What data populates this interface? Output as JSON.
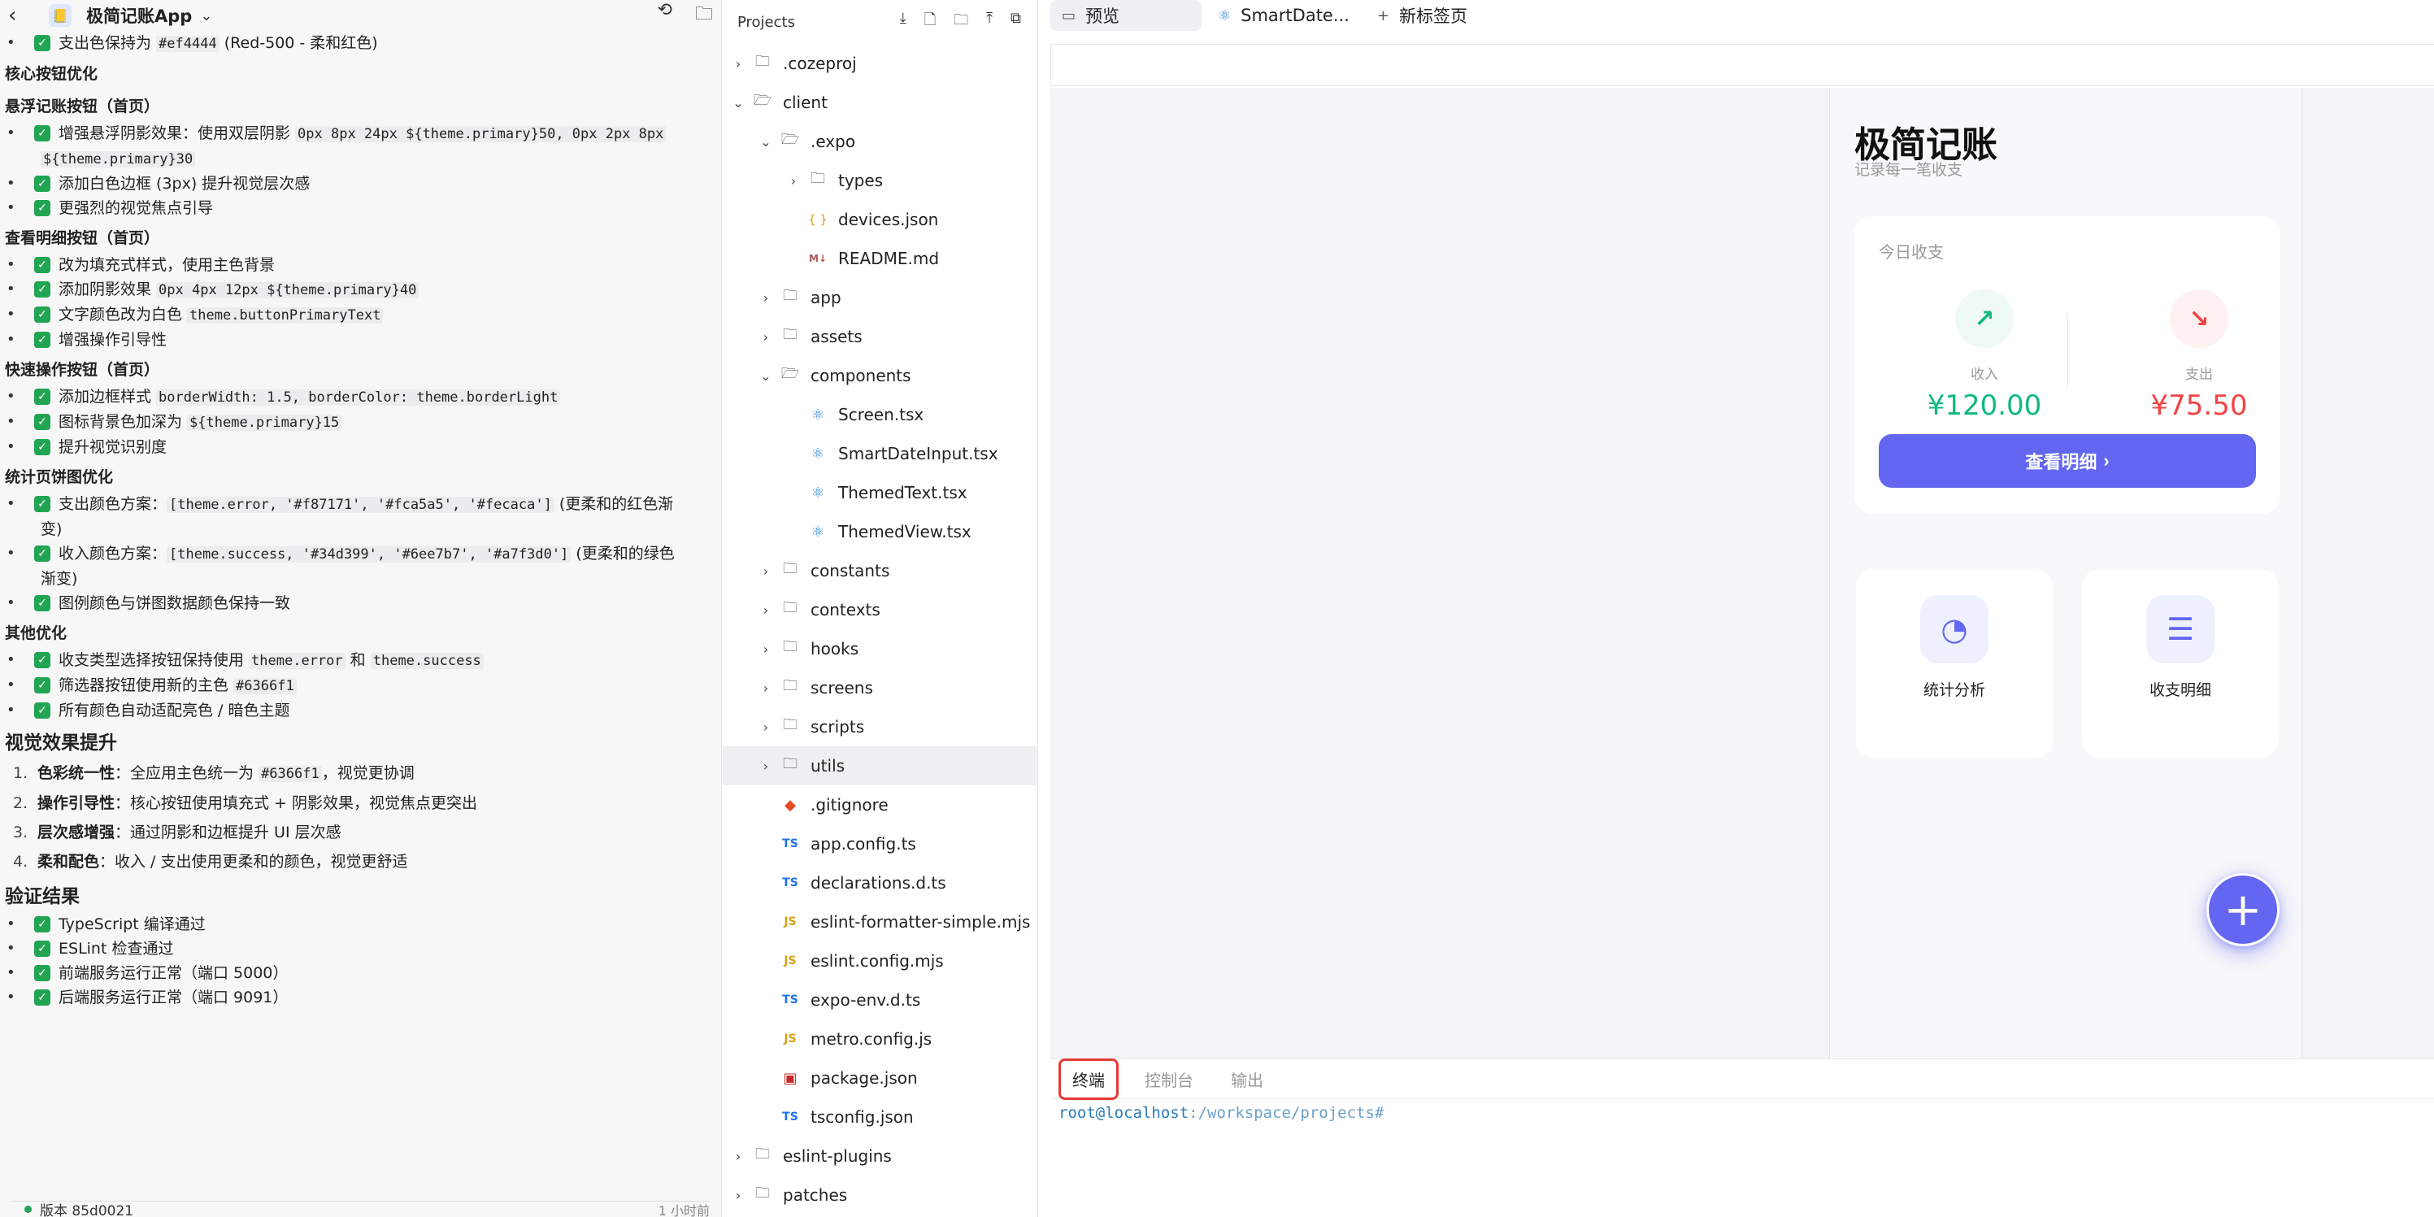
{
  "chat": {
    "app_name": "极简记账App",
    "items": [
      {
        "kind": "check",
        "text": "支出色保持为 ",
        "code": "#ef4444",
        "after": " (Red-500 - 柔和红色)"
      },
      {
        "kind": "h",
        "text": "核心按钮优化"
      },
      {
        "kind": "h",
        "text": "悬浮记账按钮（首页）"
      },
      {
        "kind": "check2",
        "line1": "增强悬浮阴影效果：使用双层阴影 ",
        "code1": "0px 8px 24px ${theme.primary}50, 0px 2px 8px",
        "code2": "${theme.primary}30"
      },
      {
        "kind": "check",
        "text": "添加白色边框 (3px) 提升视觉层次感"
      },
      {
        "kind": "check",
        "text": "更强烈的视觉焦点引导"
      },
      {
        "kind": "h",
        "text": "查看明细按钮（首页）"
      },
      {
        "kind": "check",
        "text": "改为填充式样式，使用主色背景"
      },
      {
        "kind": "check",
        "text": "添加阴影效果 ",
        "code": "0px 4px 12px ${theme.primary}40"
      },
      {
        "kind": "check",
        "text": "文字颜色改为白色 ",
        "code": "theme.buttonPrimaryText"
      },
      {
        "kind": "check",
        "text": "增强操作引导性"
      },
      {
        "kind": "h",
        "text": "快速操作按钮（首页）"
      },
      {
        "kind": "check",
        "text": "添加边框样式 ",
        "code": "borderWidth: 1.5, borderColor: theme.borderLight"
      },
      {
        "kind": "check",
        "text": "图标背景色加深为 ",
        "code": "${theme.primary}15"
      },
      {
        "kind": "check",
        "text": "提升视觉识别度"
      },
      {
        "kind": "h",
        "text": "统计页饼图优化"
      },
      {
        "kind": "check3",
        "text": "支出颜色方案：",
        "code": "[theme.error, '#f87171', '#fca5a5', '#fecaca']",
        "after": " (更柔和的红色渐",
        "wrap": "变)"
      },
      {
        "kind": "check3",
        "text": "收入颜色方案：",
        "code": "[theme.success, '#34d399', '#6ee7b7', '#a7f3d0']",
        "after": " (更柔和的绿色",
        "wrap": "渐变)"
      },
      {
        "kind": "check",
        "text": "图例颜色与饼图数据颜色保持一致"
      },
      {
        "kind": "h",
        "text": "其他优化"
      },
      {
        "kind": "check4",
        "text": "收支类型选择按钮保持使用 ",
        "code": "theme.error",
        "mid": " 和 ",
        "code2": "theme.success"
      },
      {
        "kind": "check",
        "text": "筛选器按钮使用新的主色 ",
        "code": "#6366f1"
      },
      {
        "kind": "check",
        "text": "所有颜色自动适配亮色 / 暗色主题"
      }
    ],
    "visual_heading": "视觉效果提升",
    "ordered": [
      {
        "num": "1.",
        "bold": "色彩统一性",
        "text": "：全应用主色统一为 ",
        "code": "#6366f1",
        "after": "，视觉更协调"
      },
      {
        "num": "2.",
        "bold": "操作引导性",
        "text": "：核心按钮使用填充式 + 阴影效果，视觉焦点更突出"
      },
      {
        "num": "3.",
        "bold": "层次感增强",
        "text": "：通过阴影和边框提升 UI 层次感"
      },
      {
        "num": "4.",
        "bold": "柔和配色",
        "text": "：收入 / 支出使用更柔和的颜色，视觉更舒适"
      }
    ],
    "verify_heading": "验证结果",
    "verify": [
      "TypeScript 编译通过",
      "ESLint 检查通过",
      "前端服务运行正常（端口 5000）",
      "后端服务运行正常（端口 9091）"
    ],
    "version": "版本 85d0021",
    "version_time": "1 小时前"
  },
  "tree": {
    "header": "Projects",
    "nodes": [
      {
        "depth": 0,
        "chev": "›",
        "icon": "folder",
        "name": ".cozeproj"
      },
      {
        "depth": 0,
        "chev": "⌄",
        "icon": "folder-open",
        "name": "client"
      },
      {
        "depth": 1,
        "chev": "⌄",
        "icon": "folder-open",
        "name": ".expo"
      },
      {
        "depth": 2,
        "chev": "›",
        "icon": "folder",
        "name": "types"
      },
      {
        "depth": 2,
        "chev": "",
        "icon": "json",
        "name": "devices.json"
      },
      {
        "depth": 2,
        "chev": "",
        "icon": "md",
        "name": "README.md"
      },
      {
        "depth": 1,
        "chev": "›",
        "icon": "folder",
        "name": "app"
      },
      {
        "depth": 1,
        "chev": "›",
        "icon": "folder",
        "name": "assets"
      },
      {
        "depth": 1,
        "chev": "⌄",
        "icon": "folder-open",
        "name": "components"
      },
      {
        "depth": 2,
        "chev": "",
        "icon": "react",
        "name": "Screen.tsx"
      },
      {
        "depth": 2,
        "chev": "",
        "icon": "react",
        "name": "SmartDateInput.tsx"
      },
      {
        "depth": 2,
        "chev": "",
        "icon": "react",
        "name": "ThemedText.tsx"
      },
      {
        "depth": 2,
        "chev": "",
        "icon": "react",
        "name": "ThemedView.tsx"
      },
      {
        "depth": 1,
        "chev": "›",
        "icon": "folder",
        "name": "constants"
      },
      {
        "depth": 1,
        "chev": "›",
        "icon": "folder",
        "name": "contexts"
      },
      {
        "depth": 1,
        "chev": "›",
        "icon": "folder",
        "name": "hooks"
      },
      {
        "depth": 1,
        "chev": "›",
        "icon": "folder",
        "name": "screens"
      },
      {
        "depth": 1,
        "chev": "›",
        "icon": "folder",
        "name": "scripts"
      },
      {
        "depth": 1,
        "chev": "›",
        "icon": "folder",
        "name": "utils",
        "selected": true
      },
      {
        "depth": 1,
        "chev": "",
        "icon": "git",
        "name": ".gitignore"
      },
      {
        "depth": 1,
        "chev": "",
        "icon": "ts",
        "name": "app.config.ts"
      },
      {
        "depth": 1,
        "chev": "",
        "icon": "ts",
        "name": "declarations.d.ts"
      },
      {
        "depth": 1,
        "chev": "",
        "icon": "js",
        "name": "eslint-formatter-simple.mjs"
      },
      {
        "depth": 1,
        "chev": "",
        "icon": "js",
        "name": "eslint.config.mjs"
      },
      {
        "depth": 1,
        "chev": "",
        "icon": "ts",
        "name": "expo-env.d.ts"
      },
      {
        "depth": 1,
        "chev": "",
        "icon": "js",
        "name": "metro.config.js"
      },
      {
        "depth": 1,
        "chev": "",
        "icon": "pkg",
        "name": "package.json"
      },
      {
        "depth": 1,
        "chev": "",
        "icon": "ts",
        "name": "tsconfig.json"
      },
      {
        "depth": 0,
        "chev": "›",
        "icon": "folder",
        "name": "eslint-plugins"
      },
      {
        "depth": 0,
        "chev": "›",
        "icon": "folder",
        "name": "patches"
      }
    ]
  },
  "tabs": {
    "preview": "预览",
    "file": "SmartDate...",
    "new_tab": "新标签页"
  },
  "app": {
    "title": "极简记账",
    "subtitle": "记录每一笔收支",
    "today_label": "今日收支",
    "income_label": "收入",
    "income_amount": "¥120.00",
    "expense_label": "支出",
    "expense_amount": "¥75.50",
    "detail_button": "查看明细",
    "quick_stats": "统计分析",
    "quick_list": "收支明细",
    "colors": {
      "primary": "#6366f1",
      "income": "#10b981",
      "expense": "#ef4444"
    }
  },
  "terminal": {
    "tabs": [
      "终端",
      "控制台",
      "输出"
    ],
    "prompt_user": "root@localhost",
    "prompt_path": ":/workspace/projects#"
  }
}
